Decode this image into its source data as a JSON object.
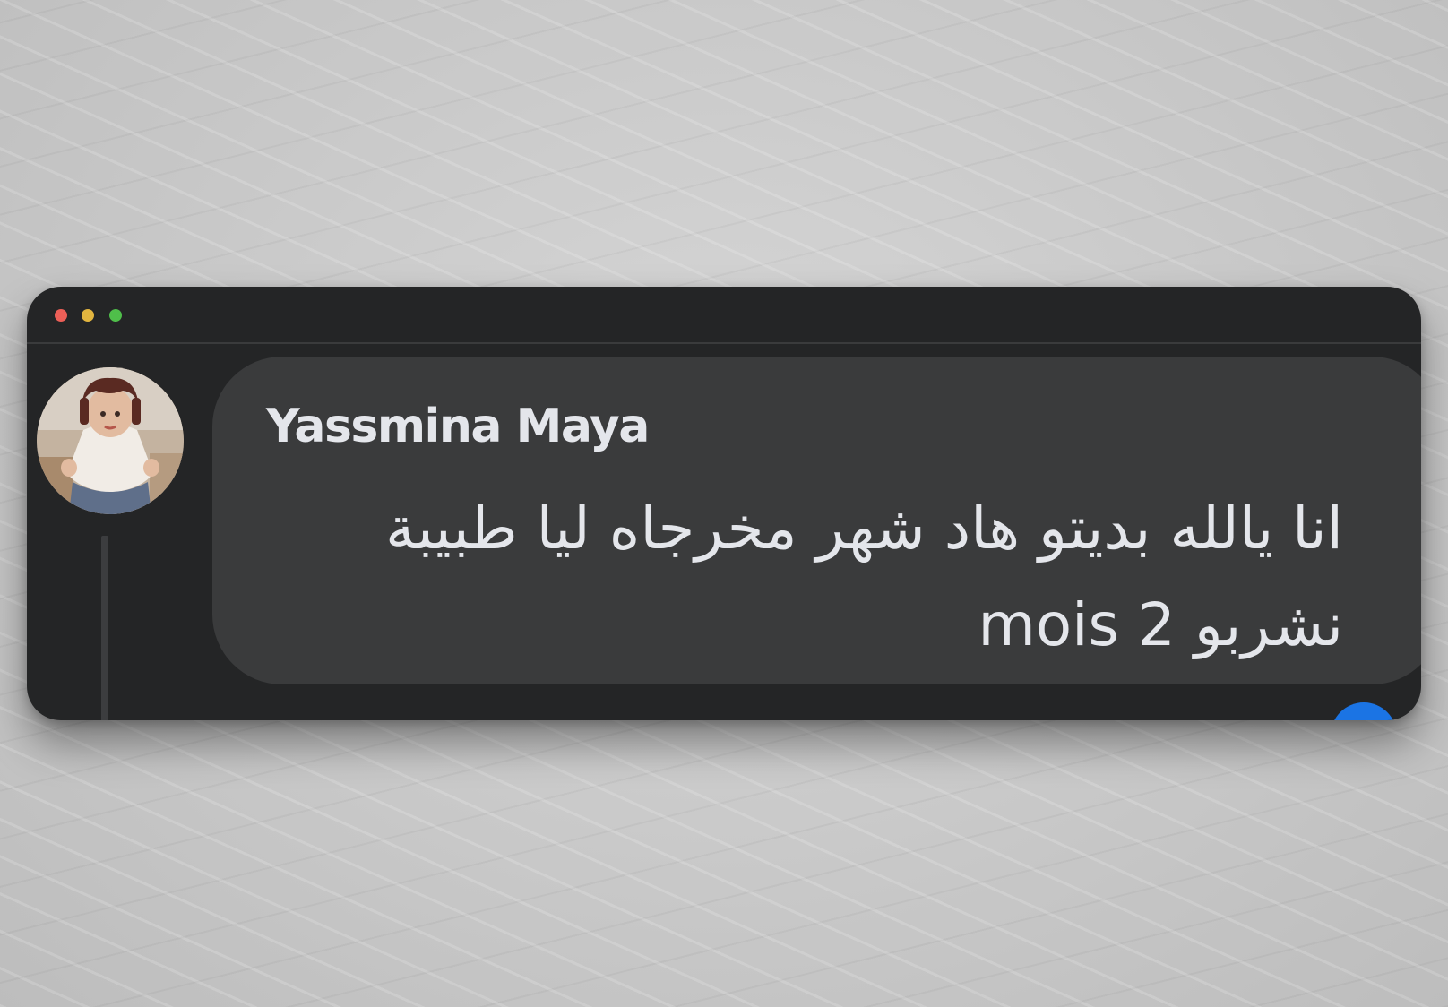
{
  "window": {
    "controls": [
      "close",
      "minimize",
      "maximize"
    ],
    "colors": {
      "background": "#242526",
      "bubble": "#3a3b3c",
      "text": "#e4e6eb",
      "close": "#ec5f57",
      "minimize": "#e2b53f",
      "maximize": "#4fbf4a",
      "reaction": "#1b74e4"
    }
  },
  "comment": {
    "author": "Yassmina Maya",
    "text": "انا يالله بديتو هاد شهر مخرجاه ليا طبيبة نشربو 2 mois",
    "avatar_icon": "user-avatar-photo",
    "reaction_icon": "like-reaction-icon"
  }
}
